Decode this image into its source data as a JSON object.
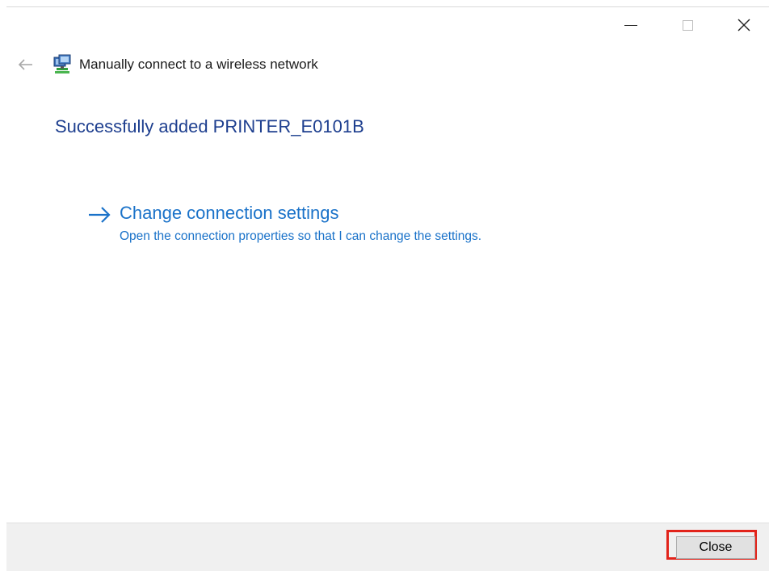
{
  "window": {
    "title": "Manually connect to a wireless network"
  },
  "caption_buttons": {
    "minimize_icon": "minimize-icon",
    "maximize_icon": "maximize-icon",
    "close_icon": "close-icon"
  },
  "header": {
    "back_icon": "back-arrow-icon",
    "network_icon": "network-icon",
    "title": "Manually connect to a wireless network"
  },
  "main": {
    "heading": "Successfully added PRINTER_E0101B",
    "command_link": {
      "icon": "arrow-right-icon",
      "title": "Change connection settings",
      "description": "Open the connection properties so that I can change the settings."
    }
  },
  "footer": {
    "close_label": "Close"
  },
  "colors": {
    "heading": "#1e3f8f",
    "link": "#1a72c9",
    "highlight": "#e2231a",
    "footer_bg": "#f0f0f0"
  }
}
